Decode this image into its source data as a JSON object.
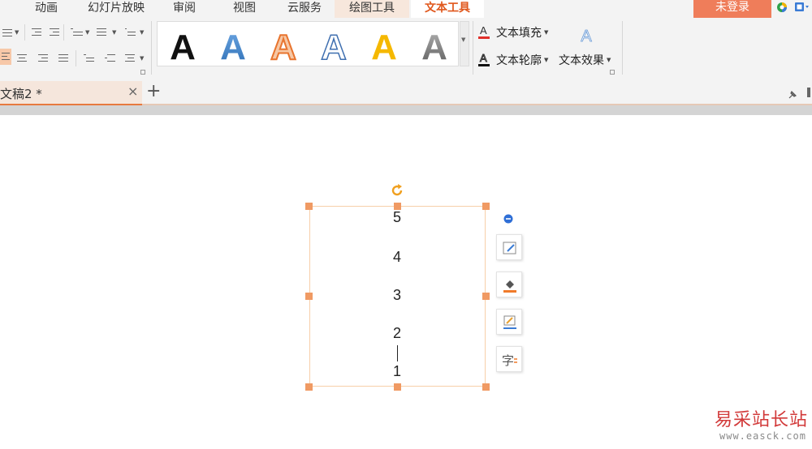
{
  "menu_tabs": [
    {
      "label": "动画"
    },
    {
      "label": "幻灯片放映"
    },
    {
      "label": "审阅"
    },
    {
      "label": "视图"
    },
    {
      "label": "云服务"
    },
    {
      "label": "绘图工具"
    },
    {
      "label": "文本工具"
    }
  ],
  "login_label": "未登录",
  "text_commands": {
    "fill_label": "文本填充",
    "outline_label": "文本轮廓",
    "effect_label": "文本效果"
  },
  "style_gallery": [
    {
      "glyph": "A",
      "name": "black-solid",
      "fill": "#111111"
    },
    {
      "glyph": "A",
      "name": "blue-gradient",
      "fill": "#4f8fd1"
    },
    {
      "glyph": "A",
      "name": "orange-outline",
      "fill": "#ec8a4f"
    },
    {
      "glyph": "A",
      "name": "blue-outline",
      "fill": "#ffffff"
    },
    {
      "glyph": "A",
      "name": "gold-solid",
      "fill": "#f5b800"
    },
    {
      "glyph": "A",
      "name": "grey-gradient",
      "fill": "#8a8a8a"
    }
  ],
  "effect_preview_glyph": "A",
  "document_tab": {
    "title": "文稿2 *",
    "close_glyph": "×",
    "add_glyph": "+"
  },
  "textbox": {
    "lines": [
      "5",
      "4",
      "3",
      "2",
      "1"
    ]
  },
  "watermark": {
    "brand": "易采站长站",
    "url": "www.easck.com"
  },
  "colors": {
    "accent_orange": "#e0571c",
    "login_bg": "#ef7d5a",
    "handle": "#f09a63",
    "watermark_red": "#d23a3a"
  }
}
